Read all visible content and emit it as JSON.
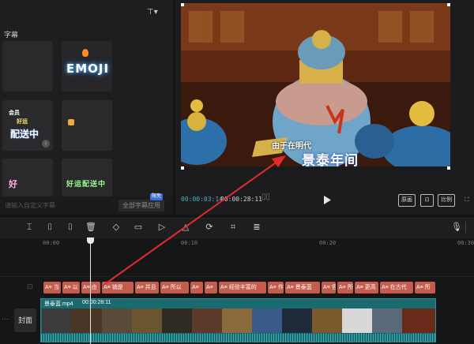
{
  "left_panel": {
    "section_label": "字幕",
    "filter_glyph": "⊤▾",
    "tiles": [
      {
        "id": "blank"
      },
      {
        "id": "emoji",
        "text": "EMOJI"
      },
      {
        "id": "delivery",
        "line1": "会员",
        "line2": "好运",
        "line3": "配送中"
      },
      {
        "id": "small"
      },
      {
        "id": "good",
        "text": "好"
      },
      {
        "id": "lucky",
        "text": "好运配送中"
      }
    ],
    "hint": "请输入自定义字幕",
    "apply_all_label": "全部字幕应用",
    "free_badge": "限免"
  },
  "player": {
    "subtitle_small": "由于在明代",
    "subtitle_big": "景泰年间",
    "time_current": "00:00:03:14",
    "time_total": "00:00:28:11",
    "buttons": {
      "ratio_a": "原画",
      "fit": "⊡",
      "ratio_b": "比例",
      "full": "⛶"
    }
  },
  "timeline": {
    "ticks": [
      "00:00",
      "00:10",
      "00:20",
      "00:30"
    ],
    "clips": [
      {
        "label": "A≡ 当"
      },
      {
        "label": "A≡ 以"
      },
      {
        "label": "A≡ 由"
      },
      {
        "label": "A≡ 销是"
      },
      {
        "label": "A≡ 并且"
      },
      {
        "label": "A≡ 所以"
      },
      {
        "label": "A≡"
      },
      {
        "label": "A≡"
      },
      {
        "label": "A≡ 经验丰富的"
      },
      {
        "label": "A≡ 作"
      },
      {
        "label": "A≡ 景泰蓝"
      },
      {
        "label": "A≡ 色"
      },
      {
        "label": "A≡ 所"
      },
      {
        "label": "A≡ 更高"
      },
      {
        "label": "A≡ 在古代"
      },
      {
        "label": "A≡ 所"
      }
    ],
    "video_clip_name": "景泰蓝.mp4",
    "video_clip_duration": "00:00:28:11",
    "cover_label": "封面",
    "more_glyph": "⋯"
  },
  "toolbar": {
    "tools": [
      "undo-split-icon",
      "split-left-icon",
      "split-right-icon",
      "delete-icon",
      "shield-icon",
      "crop-frame-icon",
      "play-circle-icon",
      "mirror-icon",
      "rotate-icon",
      "crop-icon",
      "subtitle-icon",
      "mic-icon"
    ]
  },
  "colors": {
    "accent": "#46b1c6",
    "text_clip": "#c45b4b",
    "video_clip": "#1b6a6f",
    "arrow": "#e02c2c"
  }
}
